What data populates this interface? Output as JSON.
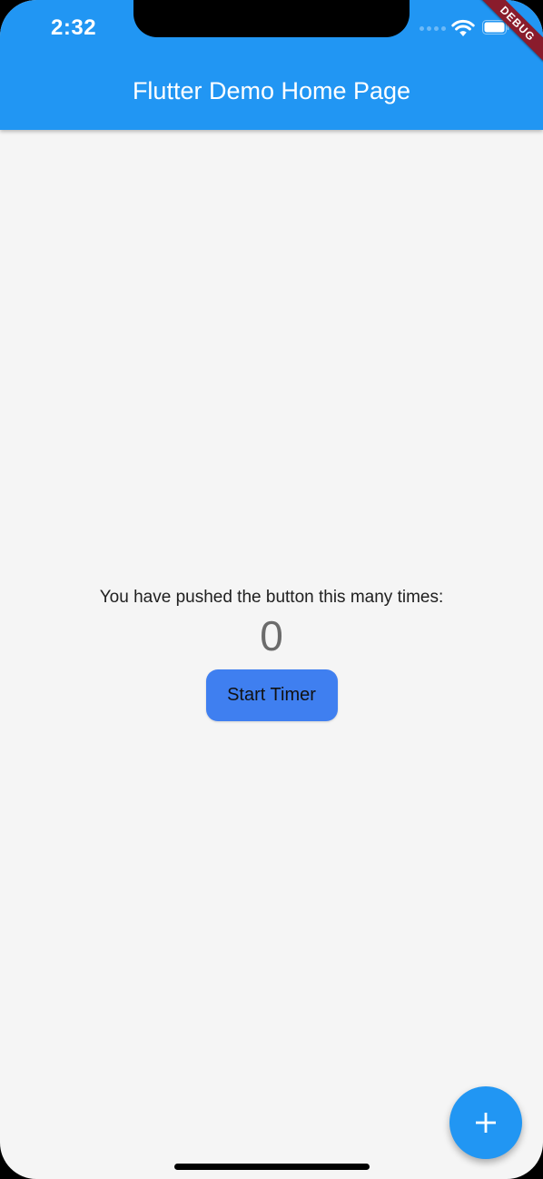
{
  "status_bar": {
    "time": "2:32",
    "wifi_icon": "wifi-icon",
    "battery_icon": "battery-icon"
  },
  "debug_banner": {
    "label": "DEBUG",
    "color": "#8a1c2c"
  },
  "app_bar": {
    "title": "Flutter Demo Home Page",
    "color": "#2196f3"
  },
  "body": {
    "caption": "You have pushed the button this many times:",
    "counter": "0",
    "start_timer_label": "Start Timer",
    "button_color": "#3f7ff0"
  },
  "fab": {
    "icon": "plus-icon",
    "color": "#2196f3"
  }
}
